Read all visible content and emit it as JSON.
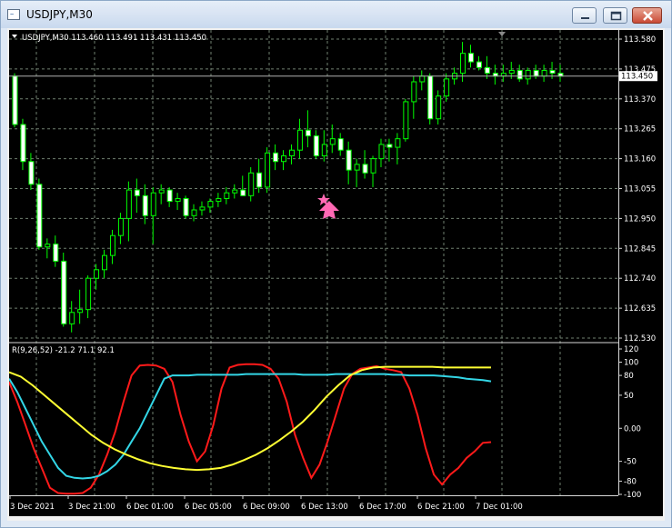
{
  "window": {
    "title": "USDJPY,M30",
    "icon_name": "chart-window-icon",
    "buttons": [
      "minimize-icon",
      "maximize-icon",
      "close-icon"
    ]
  },
  "main_chart": {
    "header": "USDJPY,M30  113.460 113.491 113.431 113.450",
    "current_price_label": "113.450",
    "price_ticks": [
      "113.580",
      "113.475",
      "113.370",
      "113.265",
      "113.160",
      "113.055",
      "112.950",
      "112.845",
      "112.740",
      "112.635",
      "112.530"
    ],
    "colors": {
      "background": "#000000",
      "bull_candle": "#00ff00",
      "bear_candle": "#ffffff",
      "grid": "#7a8a7a",
      "arrow": "#ff69b4"
    },
    "arrow_icon": "up-arrow-icon",
    "star_icon": "star-icon"
  },
  "indicator": {
    "header": "R(9,26,52) -21.2 71.1 92.1",
    "ticks": [
      "120",
      "100",
      "80",
      "50",
      "0.00",
      "-50",
      "-80",
      "-100"
    ],
    "colors": {
      "fast": "#ff1a1a",
      "mid": "#33d6e6",
      "slow": "#ffff33"
    }
  },
  "time_axis": [
    "3 Dec 2021",
    "3 Dec 21:00",
    "6 Dec 01:00",
    "6 Dec 05:00",
    "6 Dec 09:00",
    "6 Dec 13:00",
    "6 Dec 17:00",
    "6 Dec 21:00",
    "7 Dec 01:00"
  ],
  "chart_data": {
    "type": "candlestick",
    "symbol": "USDJPY",
    "timeframe": "M30",
    "ylim": [
      112.53,
      113.58
    ],
    "candles": [
      {
        "o": 113.45,
        "h": 113.46,
        "l": 113.27,
        "c": 113.28
      },
      {
        "o": 113.28,
        "h": 113.3,
        "l": 113.12,
        "c": 113.15
      },
      {
        "o": 113.15,
        "h": 113.18,
        "l": 113.05,
        "c": 113.07
      },
      {
        "o": 113.07,
        "h": 113.09,
        "l": 112.84,
        "c": 112.85
      },
      {
        "o": 112.85,
        "h": 112.88,
        "l": 112.81,
        "c": 112.86
      },
      {
        "o": 112.86,
        "h": 112.89,
        "l": 112.78,
        "c": 112.8
      },
      {
        "o": 112.8,
        "h": 112.83,
        "l": 112.57,
        "c": 112.58
      },
      {
        "o": 112.58,
        "h": 112.66,
        "l": 112.55,
        "c": 112.62
      },
      {
        "o": 112.62,
        "h": 112.7,
        "l": 112.58,
        "c": 112.63
      },
      {
        "o": 112.63,
        "h": 112.75,
        "l": 112.6,
        "c": 112.74
      },
      {
        "o": 112.74,
        "h": 112.79,
        "l": 112.7,
        "c": 112.77
      },
      {
        "o": 112.77,
        "h": 112.84,
        "l": 112.74,
        "c": 112.82
      },
      {
        "o": 112.82,
        "h": 112.91,
        "l": 112.79,
        "c": 112.89
      },
      {
        "o": 112.89,
        "h": 112.97,
        "l": 112.86,
        "c": 112.95
      },
      {
        "o": 112.95,
        "h": 113.08,
        "l": 112.87,
        "c": 113.05
      },
      {
        "o": 113.05,
        "h": 113.09,
        "l": 112.97,
        "c": 113.03
      },
      {
        "o": 113.03,
        "h": 113.07,
        "l": 112.93,
        "c": 112.96
      },
      {
        "o": 112.96,
        "h": 113.06,
        "l": 112.86,
        "c": 113.04
      },
      {
        "o": 113.04,
        "h": 113.07,
        "l": 113.0,
        "c": 113.05
      },
      {
        "o": 113.05,
        "h": 113.06,
        "l": 112.99,
        "c": 113.01
      },
      {
        "o": 113.01,
        "h": 113.04,
        "l": 112.98,
        "c": 113.02
      },
      {
        "o": 113.02,
        "h": 113.03,
        "l": 112.95,
        "c": 112.96
      },
      {
        "o": 112.96,
        "h": 113.0,
        "l": 112.94,
        "c": 112.98
      },
      {
        "o": 112.98,
        "h": 113.01,
        "l": 112.96,
        "c": 112.99
      },
      {
        "o": 112.99,
        "h": 113.02,
        "l": 112.97,
        "c": 113.01
      },
      {
        "o": 113.01,
        "h": 113.04,
        "l": 112.99,
        "c": 113.02
      },
      {
        "o": 113.02,
        "h": 113.06,
        "l": 113.0,
        "c": 113.04
      },
      {
        "o": 113.04,
        "h": 113.07,
        "l": 113.02,
        "c": 113.05
      },
      {
        "o": 113.05,
        "h": 113.1,
        "l": 113.03,
        "c": 113.03
      },
      {
        "o": 113.03,
        "h": 113.13,
        "l": 113.01,
        "c": 113.11
      },
      {
        "o": 113.11,
        "h": 113.16,
        "l": 113.04,
        "c": 113.06
      },
      {
        "o": 113.06,
        "h": 113.2,
        "l": 113.04,
        "c": 113.18
      },
      {
        "o": 113.18,
        "h": 113.21,
        "l": 113.12,
        "c": 113.15
      },
      {
        "o": 113.15,
        "h": 113.19,
        "l": 113.12,
        "c": 113.17
      },
      {
        "o": 113.17,
        "h": 113.21,
        "l": 113.14,
        "c": 113.19
      },
      {
        "o": 113.19,
        "h": 113.3,
        "l": 113.16,
        "c": 113.26
      },
      {
        "o": 113.26,
        "h": 113.33,
        "l": 113.2,
        "c": 113.24
      },
      {
        "o": 113.24,
        "h": 113.26,
        "l": 113.16,
        "c": 113.17
      },
      {
        "o": 113.17,
        "h": 113.26,
        "l": 113.15,
        "c": 113.21
      },
      {
        "o": 113.21,
        "h": 113.28,
        "l": 113.18,
        "c": 113.23
      },
      {
        "o": 113.23,
        "h": 113.25,
        "l": 113.17,
        "c": 113.19
      },
      {
        "o": 113.19,
        "h": 113.22,
        "l": 113.07,
        "c": 113.12
      },
      {
        "o": 113.12,
        "h": 113.16,
        "l": 113.06,
        "c": 113.14
      },
      {
        "o": 113.14,
        "h": 113.19,
        "l": 113.09,
        "c": 113.11
      },
      {
        "o": 113.11,
        "h": 113.17,
        "l": 113.06,
        "c": 113.16
      },
      {
        "o": 113.16,
        "h": 113.23,
        "l": 113.13,
        "c": 113.21
      },
      {
        "o": 113.21,
        "h": 113.23,
        "l": 113.15,
        "c": 113.2
      },
      {
        "o": 113.2,
        "h": 113.25,
        "l": 113.14,
        "c": 113.23
      },
      {
        "o": 113.23,
        "h": 113.37,
        "l": 113.22,
        "c": 113.36
      },
      {
        "o": 113.36,
        "h": 113.45,
        "l": 113.3,
        "c": 113.43
      },
      {
        "o": 113.43,
        "h": 113.47,
        "l": 113.4,
        "c": 113.45
      },
      {
        "o": 113.45,
        "h": 113.46,
        "l": 113.28,
        "c": 113.3
      },
      {
        "o": 113.3,
        "h": 113.4,
        "l": 113.28,
        "c": 113.38
      },
      {
        "o": 113.38,
        "h": 113.46,
        "l": 113.36,
        "c": 113.44
      },
      {
        "o": 113.44,
        "h": 113.48,
        "l": 113.42,
        "c": 113.46
      },
      {
        "o": 113.46,
        "h": 113.57,
        "l": 113.43,
        "c": 113.53
      },
      {
        "o": 113.53,
        "h": 113.56,
        "l": 113.48,
        "c": 113.5
      },
      {
        "o": 113.5,
        "h": 113.52,
        "l": 113.47,
        "c": 113.48
      },
      {
        "o": 113.48,
        "h": 113.52,
        "l": 113.44,
        "c": 113.46
      },
      {
        "o": 113.46,
        "h": 113.49,
        "l": 113.42,
        "c": 113.45
      },
      {
        "o": 113.45,
        "h": 113.49,
        "l": 113.43,
        "c": 113.46
      },
      {
        "o": 113.46,
        "h": 113.5,
        "l": 113.44,
        "c": 113.47
      },
      {
        "o": 113.47,
        "h": 113.49,
        "l": 113.43,
        "c": 113.44
      },
      {
        "o": 113.44,
        "h": 113.48,
        "l": 113.42,
        "c": 113.47
      },
      {
        "o": 113.47,
        "h": 113.49,
        "l": 113.44,
        "c": 113.45
      },
      {
        "o": 113.45,
        "h": 113.49,
        "l": 113.43,
        "c": 113.47
      },
      {
        "o": 113.47,
        "h": 113.5,
        "l": 113.44,
        "c": 113.46
      },
      {
        "o": 113.46,
        "h": 113.49,
        "l": 113.43,
        "c": 113.45
      }
    ],
    "indicator": {
      "name": "R(9,26,52)",
      "ylim": [
        -100,
        120
      ],
      "series": [
        {
          "name": "9",
          "values": [
            70,
            40,
            5,
            -30,
            -60,
            -90,
            -98,
            -99,
            -99,
            -98,
            -90,
            -70,
            -40,
            -5,
            40,
            80,
            95,
            96,
            95,
            90,
            70,
            20,
            -20,
            -50,
            -35,
            5,
            60,
            92,
            96,
            97,
            97,
            96,
            90,
            75,
            40,
            -10,
            -45,
            -75,
            -55,
            -20,
            20,
            60,
            82,
            90,
            92,
            94,
            90,
            88,
            85,
            60,
            20,
            -30,
            -70,
            -85,
            -70,
            -60,
            -45,
            -35,
            -22,
            -21
          ]
        },
        {
          "name": "26",
          "values": [
            75,
            55,
            30,
            5,
            -20,
            -40,
            -60,
            -72,
            -75,
            -76,
            -75,
            -72,
            -65,
            -55,
            -40,
            -20,
            0,
            25,
            50,
            75,
            80,
            80,
            80,
            81,
            81,
            81,
            81,
            81,
            81,
            82,
            82,
            82,
            82,
            82,
            82,
            82,
            81,
            81,
            81,
            81,
            82,
            82,
            82,
            82,
            82,
            82,
            82,
            81,
            81,
            80,
            80,
            80,
            80,
            79,
            78,
            77,
            75,
            74,
            73,
            71
          ]
        },
        {
          "name": "52",
          "values": [
            85,
            78,
            65,
            50,
            35,
            20,
            5,
            -10,
            -22,
            -32,
            -40,
            -47,
            -53,
            -57,
            -60,
            -62,
            -63,
            -62,
            -60,
            -55,
            -48,
            -40,
            -30,
            -18,
            -5,
            10,
            28,
            48,
            65,
            80,
            88,
            92,
            93,
            93,
            93,
            93,
            93,
            92,
            92,
            92,
            92,
            92
          ]
        }
      ]
    }
  }
}
